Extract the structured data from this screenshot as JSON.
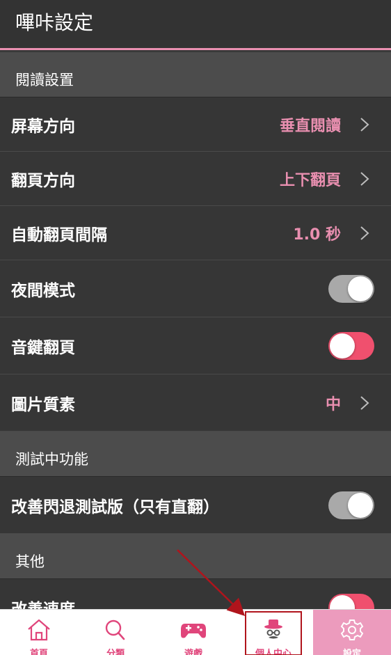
{
  "appbar": {
    "title": "嗶咔設定"
  },
  "sections": [
    {
      "header": "閱讀設置"
    },
    {
      "header": "測試中功能"
    },
    {
      "header": "其他"
    }
  ],
  "reading": {
    "screen_orientation": {
      "label": "屏幕方向",
      "value": "垂直閱讀"
    },
    "page_direction": {
      "label": "翻頁方向",
      "value": "上下翻頁"
    },
    "auto_page_interval": {
      "label": "自動翻頁間隔",
      "value": "1.0 秒"
    },
    "night_mode": {
      "label": "夜間模式",
      "enabled": false
    },
    "volume_key_flip": {
      "label": "音鍵翻頁",
      "enabled": true
    },
    "image_quality": {
      "label": "圖片質素",
      "value": "中"
    }
  },
  "testing": {
    "crash_fix_beta": {
      "label": "改善閃退測試版（只有直翻）",
      "enabled": false
    }
  },
  "other": {
    "improve_speed": {
      "label": "改善速度",
      "enabled": true
    }
  },
  "bottom_nav": {
    "tabs": [
      {
        "label": "首頁",
        "icon": "home-icon"
      },
      {
        "label": "分類",
        "icon": "search-icon"
      },
      {
        "label": "遊戲",
        "icon": "gamepad-icon"
      },
      {
        "label": "個人中心",
        "icon": "profile-hat-icon"
      },
      {
        "label": "設定",
        "icon": "gear-icon",
        "active": true
      }
    ]
  },
  "colors": {
    "accent": "#e98fb0",
    "toggle_on": "#f0506e",
    "toggle_off": "#a9a9a9",
    "annotation": "#b0141c"
  }
}
